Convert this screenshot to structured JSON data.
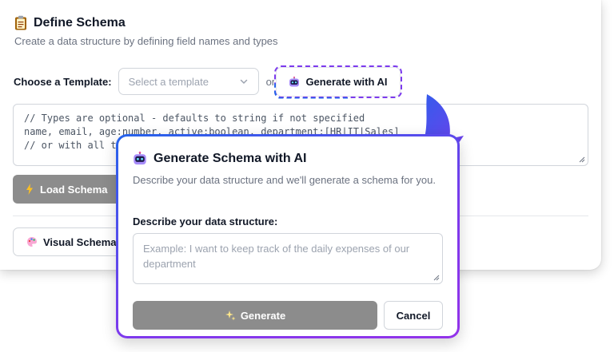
{
  "schema": {
    "title": "Define Schema",
    "subtitle": "Create a data structure by defining field names and types",
    "template_label": "Choose a Template:",
    "template_placeholder": "Select a template",
    "or_text": "or",
    "generate_ai_label": "Generate with AI",
    "code_lines": [
      "// Types are optional - defaults to string if not specified",
      "name, email, age:number, active:boolean, department:[HR|IT|Sales]",
      "// or with all types specified"
    ],
    "load_label": "Load Schema",
    "visual_label": "Visual Schema"
  },
  "modal": {
    "title": "Generate Schema with AI",
    "description": "Describe your data structure and we'll generate a schema for you.",
    "field_label": "Describe your data structure:",
    "placeholder": "Example: I want to keep track of the daily expenses of our department",
    "generate_label": "Generate",
    "cancel_label": "Cancel"
  },
  "colors": {
    "accent_blue": "#2563eb",
    "accent_purple": "#7c3aed",
    "disabled_button": "#8c8c8c"
  },
  "icons": {
    "title": "clipboard-icon",
    "ai": "robot-icon",
    "load": "lightning-icon",
    "visual": "palette-icon",
    "generate": "sparkles-icon"
  }
}
